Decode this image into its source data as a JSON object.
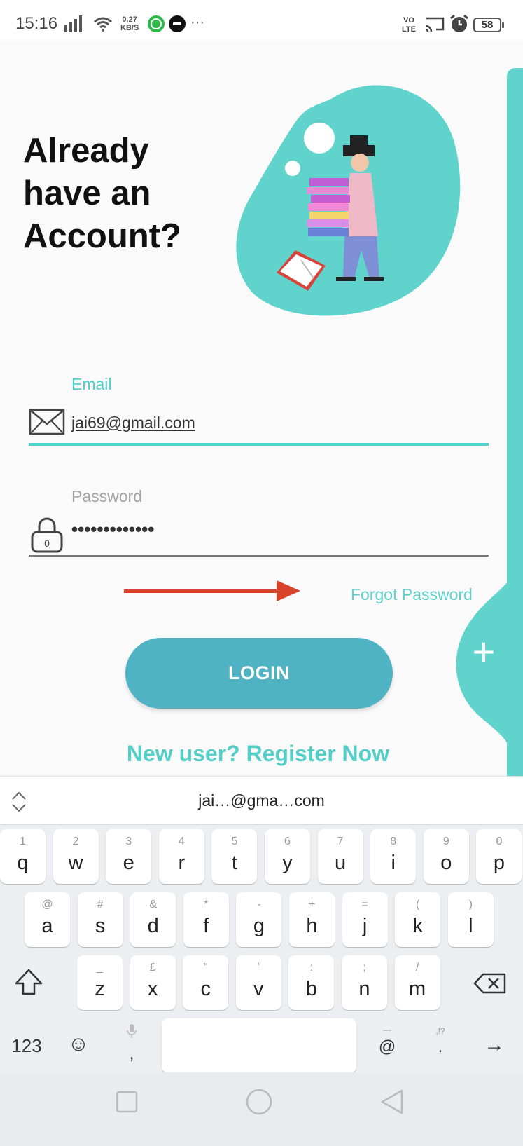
{
  "status": {
    "time": "15:16",
    "net_speed_value": "0.27",
    "net_speed_unit": "KB/S",
    "lte": "VO LTE",
    "battery": "58",
    "more": "···"
  },
  "login": {
    "title": "Already\nhave an\nAccount?",
    "email_label": "Email",
    "email_value": "jai69@gmail.com",
    "password_label": "Password",
    "password_value": "•••••••••••••",
    "forgot_label": "Forgot Password",
    "login_button": "LOGIN",
    "register_link": "New user? Register Now",
    "fab_label": "+"
  },
  "keyboard": {
    "suggestion": "jai…@gma…com",
    "row1": [
      {
        "ch": "q",
        "hint": "1"
      },
      {
        "ch": "w",
        "hint": "2"
      },
      {
        "ch": "e",
        "hint": "3"
      },
      {
        "ch": "r",
        "hint": "4"
      },
      {
        "ch": "t",
        "hint": "5"
      },
      {
        "ch": "y",
        "hint": "6"
      },
      {
        "ch": "u",
        "hint": "7"
      },
      {
        "ch": "i",
        "hint": "8"
      },
      {
        "ch": "o",
        "hint": "9"
      },
      {
        "ch": "p",
        "hint": "0"
      }
    ],
    "row2": [
      {
        "ch": "a",
        "hint": "@"
      },
      {
        "ch": "s",
        "hint": "#"
      },
      {
        "ch": "d",
        "hint": "&"
      },
      {
        "ch": "f",
        "hint": "*"
      },
      {
        "ch": "g",
        "hint": "-"
      },
      {
        "ch": "h",
        "hint": "+"
      },
      {
        "ch": "j",
        "hint": "="
      },
      {
        "ch": "k",
        "hint": "("
      },
      {
        "ch": "l",
        "hint": ")"
      }
    ],
    "row3": [
      {
        "ch": "z",
        "hint": "_"
      },
      {
        "ch": "x",
        "hint": "£"
      },
      {
        "ch": "c",
        "hint": "\""
      },
      {
        "ch": "v",
        "hint": "'"
      },
      {
        "ch": "b",
        "hint": ":"
      },
      {
        "ch": "n",
        "hint": ";"
      },
      {
        "ch": "m",
        "hint": "/"
      }
    ],
    "numbers_key": "123",
    "emoji_key": "☺",
    "comma_key": ",",
    "at_key": "@",
    "at_hint": "—",
    "period_key": ".",
    "period_hint": ",!?",
    "enter_key": "→"
  },
  "colors": {
    "accent": "#4fd2cc",
    "button": "#4fb3c4",
    "arrow": "#d9432a"
  }
}
